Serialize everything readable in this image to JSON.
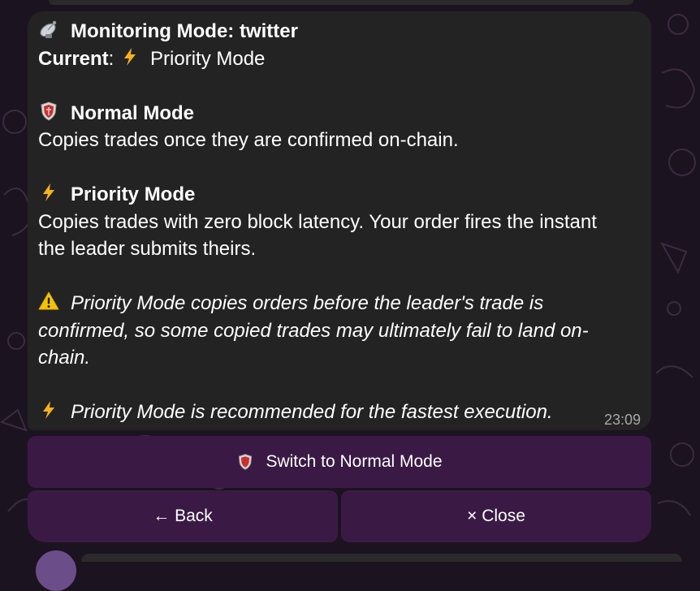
{
  "message": {
    "title": "Monitoring Mode: twitter",
    "current_label": "Current",
    "current_value": "Priority Mode",
    "normal_heading": "Normal Mode",
    "normal_desc": "Copies trades once they are confirmed on-chain.",
    "priority_heading": "Priority Mode",
    "priority_desc_1": "Copies trades with zero block latency. Your order fires the instant",
    "priority_desc_2": "the leader submits theirs.",
    "warning_1": "Priority Mode copies orders before the leader's trade is",
    "warning_2": "confirmed, so some copied trades may ultimately fail to land on-",
    "warning_3": "chain.",
    "recommend": "Priority Mode is recommended for the fastest execution.",
    "time": "23:09"
  },
  "buttons": {
    "switch_label": "Switch to Normal Mode",
    "back_label": "← Back",
    "close_label": "× Close"
  },
  "icons": {
    "title": "satellite-antenna-icon",
    "normal": "shield-icon",
    "priority": "lightning-icon",
    "warning": "warning-icon"
  },
  "colors": {
    "background": "#1c1320",
    "bubble": "#232323",
    "button": "#3a1a45",
    "timestamp": "#a7a7a7",
    "lightning": "#f5b21a",
    "warning": "#f5c400",
    "shield": "#c9302c"
  }
}
